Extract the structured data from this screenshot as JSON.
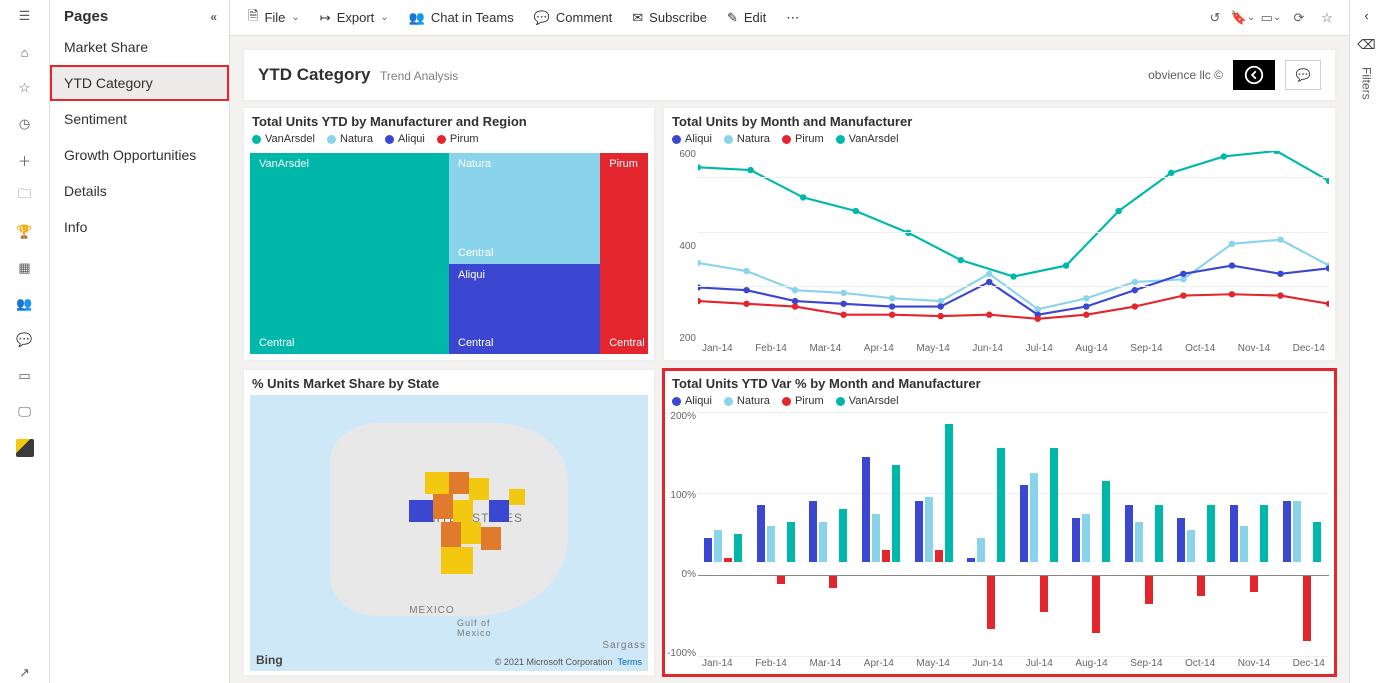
{
  "colors": {
    "vanarsdel": "#00b8aa",
    "natura": "#8ad4eb",
    "aliqui": "#3b46d1",
    "pirum": "#e3262e"
  },
  "toolbar": {
    "file": "File",
    "export": "Export",
    "chat": "Chat in Teams",
    "comment": "Comment",
    "subscribe": "Subscribe",
    "edit": "Edit"
  },
  "pages": {
    "title": "Pages",
    "items": [
      "Market Share",
      "YTD Category",
      "Sentiment",
      "Growth Opportunities",
      "Details",
      "Info"
    ],
    "active": 1
  },
  "report": {
    "title": "YTD Category",
    "subtitle": "Trend Analysis",
    "brand": "obvience llc ©"
  },
  "filters_label": "Filters",
  "map": {
    "title": "% Units Market Share by State",
    "country": "UNITED STATES",
    "mexico": "MEXICO",
    "gulf": "Gulf of\nMexico",
    "sargasso": "Sargass",
    "provider": "Bing",
    "credit": "© 2021 Microsoft Corporation",
    "terms": "Terms"
  },
  "chart_data": [
    {
      "id": "treemap",
      "type": "treemap",
      "title": "Total Units YTD by Manufacturer and Region",
      "legend": [
        "VanArsdel",
        "Natura",
        "Aliqui",
        "Pirum"
      ],
      "nodes": [
        {
          "name": "VanArsdel",
          "region": "Central",
          "value": 50,
          "color": "#00b8aa"
        },
        {
          "name": "Natura",
          "region": "Central",
          "value": 18,
          "color": "#8ad4eb"
        },
        {
          "name": "Aliqui",
          "region": "Central",
          "value": 14,
          "color": "#3b46d1"
        },
        {
          "name": "Pirum",
          "region": "Central",
          "value": 8,
          "color": "#e3262e"
        }
      ]
    },
    {
      "id": "line",
      "type": "line",
      "title": "Total Units by Month and Manufacturer",
      "legend": [
        "Aliqui",
        "Natura",
        "Pirum",
        "VanArsdel"
      ],
      "categories": [
        "Jan-14",
        "Feb-14",
        "Mar-14",
        "Apr-14",
        "May-14",
        "Jun-14",
        "Jul-14",
        "Aug-14",
        "Sep-14",
        "Oct-14",
        "Nov-14",
        "Dec-14"
      ],
      "ylim": [
        0,
        700
      ],
      "yticks": [
        200,
        400,
        600
      ],
      "series": [
        {
          "name": "VanArsdel",
          "color": "#00b8aa",
          "values": [
            640,
            630,
            530,
            480,
            400,
            300,
            240,
            280,
            480,
            620,
            680,
            700,
            590
          ]
        },
        {
          "name": "Natura",
          "color": "#8ad4eb",
          "values": [
            290,
            260,
            190,
            180,
            160,
            150,
            250,
            120,
            160,
            220,
            230,
            360,
            375,
            280
          ]
        },
        {
          "name": "Aliqui",
          "color": "#3b46d1",
          "values": [
            200,
            190,
            150,
            140,
            130,
            130,
            220,
            100,
            130,
            190,
            250,
            280,
            250,
            270
          ]
        },
        {
          "name": "Pirum",
          "color": "#e3262e",
          "values": [
            150,
            140,
            130,
            100,
            100,
            95,
            100,
            85,
            100,
            130,
            170,
            175,
            170,
            140
          ]
        }
      ]
    },
    {
      "id": "bar",
      "type": "bar",
      "title": "Total Units YTD Var % by Month and Manufacturer",
      "legend": [
        "Aliqui",
        "Natura",
        "Pirum",
        "VanArsdel"
      ],
      "categories": [
        "Jan-14",
        "Feb-14",
        "Mar-14",
        "Apr-14",
        "May-14",
        "Jun-14",
        "Jul-14",
        "Aug-14",
        "Sep-14",
        "Oct-14",
        "Nov-14",
        "Dec-14"
      ],
      "ylim": [
        -100,
        200
      ],
      "yticks": [
        -100,
        0,
        100,
        200
      ],
      "series": [
        {
          "name": "Aliqui",
          "color": "#3b46d1",
          "values": [
            30,
            70,
            75,
            130,
            75,
            5,
            95,
            55,
            70,
            55,
            70,
            75
          ]
        },
        {
          "name": "Natura",
          "color": "#8ad4eb",
          "values": [
            40,
            45,
            50,
            60,
            80,
            30,
            110,
            60,
            50,
            40,
            45,
            75
          ]
        },
        {
          "name": "Pirum",
          "color": "#e3262e",
          "values": [
            5,
            -10,
            -15,
            15,
            15,
            -65,
            -45,
            -70,
            -35,
            -25,
            -20,
            -80
          ]
        },
        {
          "name": "VanArsdel",
          "color": "#00b8aa",
          "values": [
            35,
            50,
            65,
            120,
            170,
            140,
            140,
            100,
            70,
            70,
            70,
            50
          ]
        }
      ]
    }
  ]
}
